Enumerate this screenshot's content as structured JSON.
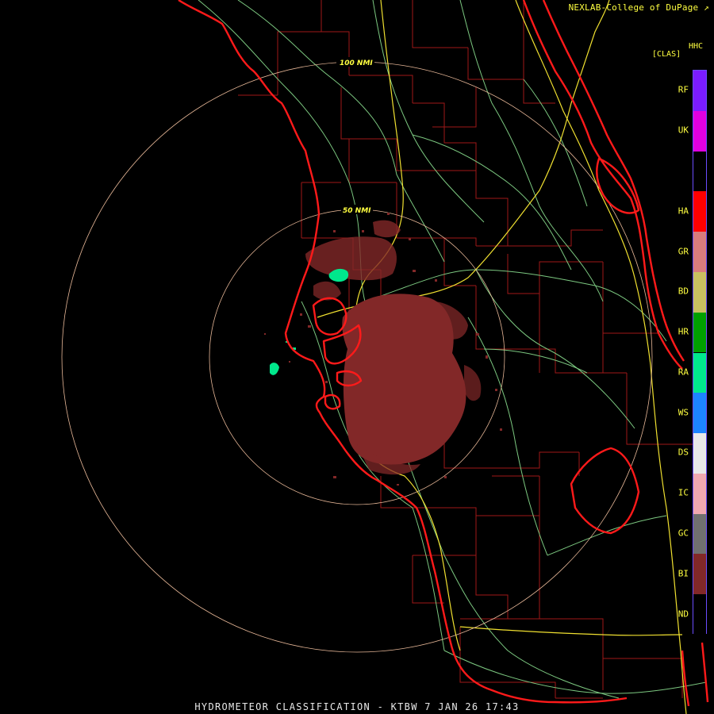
{
  "credit": "NEXLAB-College of DuPage",
  "product_code": "HHC",
  "class_label": "[CLAS]",
  "rings": [
    {
      "label": "100 NMI"
    },
    {
      "label": "50 NMI"
    }
  ],
  "legend": [
    {
      "code": "RF",
      "color": "#7b1cff"
    },
    {
      "code": "UK",
      "color": "#e000e0"
    },
    {
      "code": "",
      "color": "#000000"
    },
    {
      "code": "HA",
      "color": "#ff0000"
    },
    {
      "code": "GR",
      "color": "#d87c7c"
    },
    {
      "code": "BD",
      "color": "#c8c060"
    },
    {
      "code": "HR",
      "color": "#00a000"
    },
    {
      "code": "RA",
      "color": "#00e88c"
    },
    {
      "code": "WS",
      "color": "#1c84ff"
    },
    {
      "code": "DS",
      "color": "#e8e8e8"
    },
    {
      "code": "IC",
      "color": "#f0a8b0"
    },
    {
      "code": "GC",
      "color": "#707070"
    },
    {
      "code": "BI",
      "color": "#822828"
    },
    {
      "code": "ND",
      "color": "#000000"
    }
  ],
  "footer": "HYDROMETEOR CLASSIFICATION - KTBW 7 JAN 26 17:43"
}
